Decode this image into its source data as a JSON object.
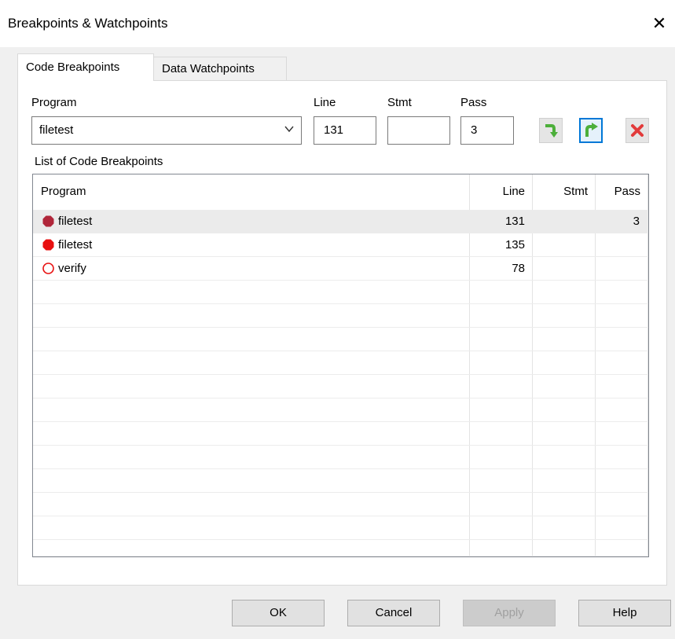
{
  "window": {
    "title": "Breakpoints & Watchpoints",
    "close_glyph": "✕"
  },
  "tabs": [
    {
      "label": "Code Breakpoints",
      "active": true
    },
    {
      "label": "Data Watchpoints",
      "active": false
    }
  ],
  "form": {
    "program_label": "Program",
    "program_value": "filetest",
    "line_label": "Line",
    "line_value": "131",
    "stmt_label": "Stmt",
    "stmt_value": "",
    "pass_label": "Pass",
    "pass_value": "3"
  },
  "toolbar": {
    "icons": [
      "arrow-down-right-icon",
      "arrow-up-right-icon",
      "delete-x-icon"
    ],
    "accent": "#0078d7",
    "green": "#4caf3a",
    "red": "#e23a3a"
  },
  "list": {
    "caption": "List of Code Breakpoints",
    "columns": [
      "Program",
      "Line",
      "Stmt",
      "Pass"
    ],
    "rows": [
      {
        "program": "filetest",
        "line": "131",
        "stmt": "",
        "pass": "3",
        "icon": "breakpoint-disabled-octagon-icon"
      },
      {
        "program": "filetest",
        "line": "135",
        "stmt": "",
        "pass": "",
        "icon": "breakpoint-active-octagon-icon"
      },
      {
        "program": "verify",
        "line": "78",
        "stmt": "",
        "pass": "",
        "icon": "breakpoint-inactive-circle-icon"
      }
    ]
  },
  "buttons": {
    "ok": "OK",
    "cancel": "Cancel",
    "apply": "Apply",
    "help": "Help"
  }
}
